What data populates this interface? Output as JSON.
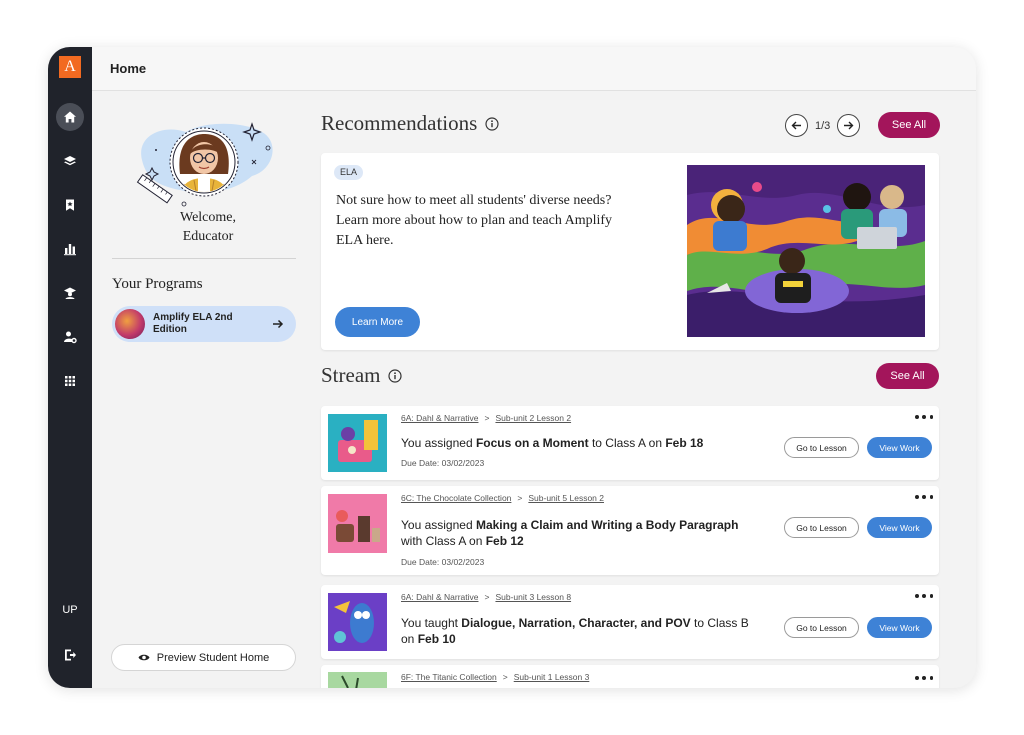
{
  "rail": {
    "logo": "A",
    "user_initials": "UP"
  },
  "topbar": {
    "title": "Home"
  },
  "profile": {
    "welcome_line1": "Welcome,",
    "welcome_line2": "Educator"
  },
  "programs": {
    "heading": "Your Programs",
    "items": [
      {
        "label": "Amplify ELA 2nd Edition"
      }
    ]
  },
  "preview_button": "Preview Student Home",
  "recommendations": {
    "heading": "Recommendations",
    "pager": "1/3",
    "see_all": "See All",
    "card": {
      "tag": "ELA",
      "text": "Not sure how to meet all students' diverse needs? Learn more about how to plan and teach Amplify ELA here.",
      "button": "Learn More"
    }
  },
  "stream": {
    "heading": "Stream",
    "see_all": "See All",
    "items": [
      {
        "crumb_unit": "6A: Dahl & Narrative",
        "crumb_lesson": "Sub-unit 2 Lesson 2",
        "prefix": "You assigned ",
        "title": "Focus on a Moment",
        "middle": " to Class A on ",
        "date": "Feb 18",
        "due": "Due Date: 03/02/2023",
        "goto": "Go to Lesson",
        "view": "View Work"
      },
      {
        "crumb_unit": "6C: The Chocolate Collection",
        "crumb_lesson": "Sub-unit 5 Lesson 2",
        "prefix": "You assigned ",
        "title": "Making a Claim and Writing a Body Paragraph",
        "middle": " with Class A on ",
        "date": "Feb 12",
        "due": "Due Date: 03/02/2023",
        "goto": "Go to Lesson",
        "view": "View Work"
      },
      {
        "crumb_unit": "6A: Dahl & Narrative",
        "crumb_lesson": "Sub-unit 3 Lesson 8",
        "prefix": "You taught ",
        "title": "Dialogue, Narration, Character, and POV",
        "middle": " to Class B on ",
        "date": "Feb 10",
        "goto": "Go to Lesson",
        "view": "View Work"
      },
      {
        "crumb_unit": "6F: The Titanic Collection",
        "crumb_lesson": "Sub-unit 1 Lesson 3"
      }
    ]
  },
  "colors": {
    "rail": "#20232b",
    "accent_magenta": "#a3155b",
    "primary_blue": "#3e82d6",
    "logo_orange": "#f26a21"
  }
}
